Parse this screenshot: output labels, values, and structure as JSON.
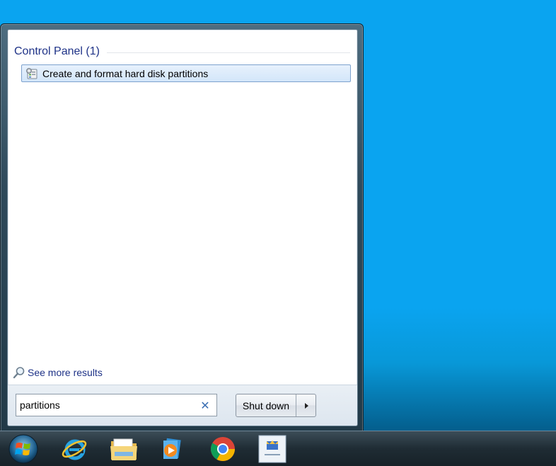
{
  "start_menu": {
    "group_title": "Control Panel (1)",
    "results": [
      {
        "label": "Create and format hard disk partitions",
        "icon": "control-panel-tool-icon"
      }
    ],
    "see_more_label": "See more results",
    "search": {
      "value": "partitions"
    },
    "shutdown_label": "Shut down"
  },
  "taskbar": {
    "items": [
      {
        "name": "start-orb",
        "icon": "windows-logo-icon"
      },
      {
        "name": "internet-explorer",
        "icon": "internet-explorer-icon"
      },
      {
        "name": "windows-explorer",
        "icon": "folder-icon"
      },
      {
        "name": "media-player",
        "icon": "media-player-icon"
      },
      {
        "name": "google-chrome",
        "icon": "chrome-icon"
      },
      {
        "name": "intel-app",
        "icon": "app-icon"
      }
    ]
  },
  "colors": {
    "desktop": "#0aa4f0",
    "group_title": "#1e3287",
    "highlight_border": "#7da2ce",
    "highlight_fill": "#d3e6fa"
  }
}
